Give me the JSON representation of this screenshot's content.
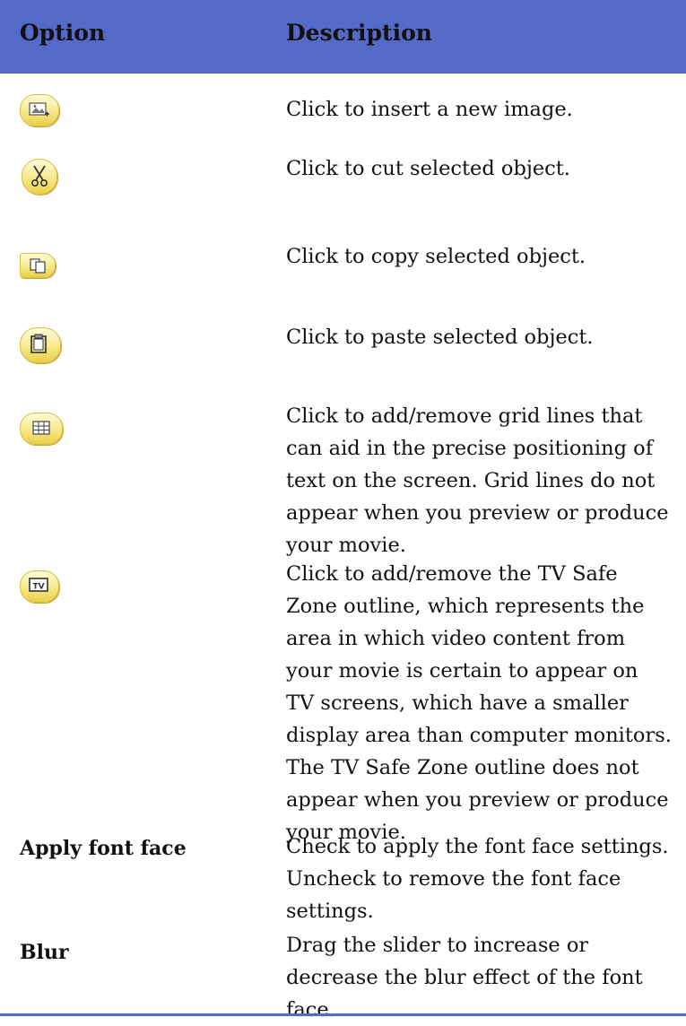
{
  "header": {
    "option_label": "Option",
    "description_label": "Description"
  },
  "rows": [
    {
      "icon": "insert-image-icon",
      "description": "Click to insert a new image."
    },
    {
      "icon": "cut-icon",
      "description": "Click to cut selected object."
    },
    {
      "icon": "copy-icon",
      "description": "Click to copy selected object."
    },
    {
      "icon": "paste-icon",
      "description": "Click to paste selected object."
    },
    {
      "icon": "grid-lines-icon",
      "description": "Click to add/remove grid lines that can aid in the precise positioning of text on the screen. Grid lines do not appear when you preview or produce your movie."
    },
    {
      "icon": "tv-safe-zone-icon",
      "description": "Click to add/remove the TV Safe Zone outline, which represents the area in which video content from your movie is certain to appear on TV screens, which have a smaller display area than computer monitors. The TV Safe Zone outline does not appear when you preview or produce your movie."
    },
    {
      "option": "Apply font face",
      "description": "Check to apply the font face settings. Uncheck to remove the font face settings."
    },
    {
      "option": "Blur",
      "description": "Drag the slider to increase or decrease the blur effect of the font face."
    }
  ],
  "colors": {
    "header_bg": "#5569c9",
    "icon_yellow": "#f7e98a"
  }
}
